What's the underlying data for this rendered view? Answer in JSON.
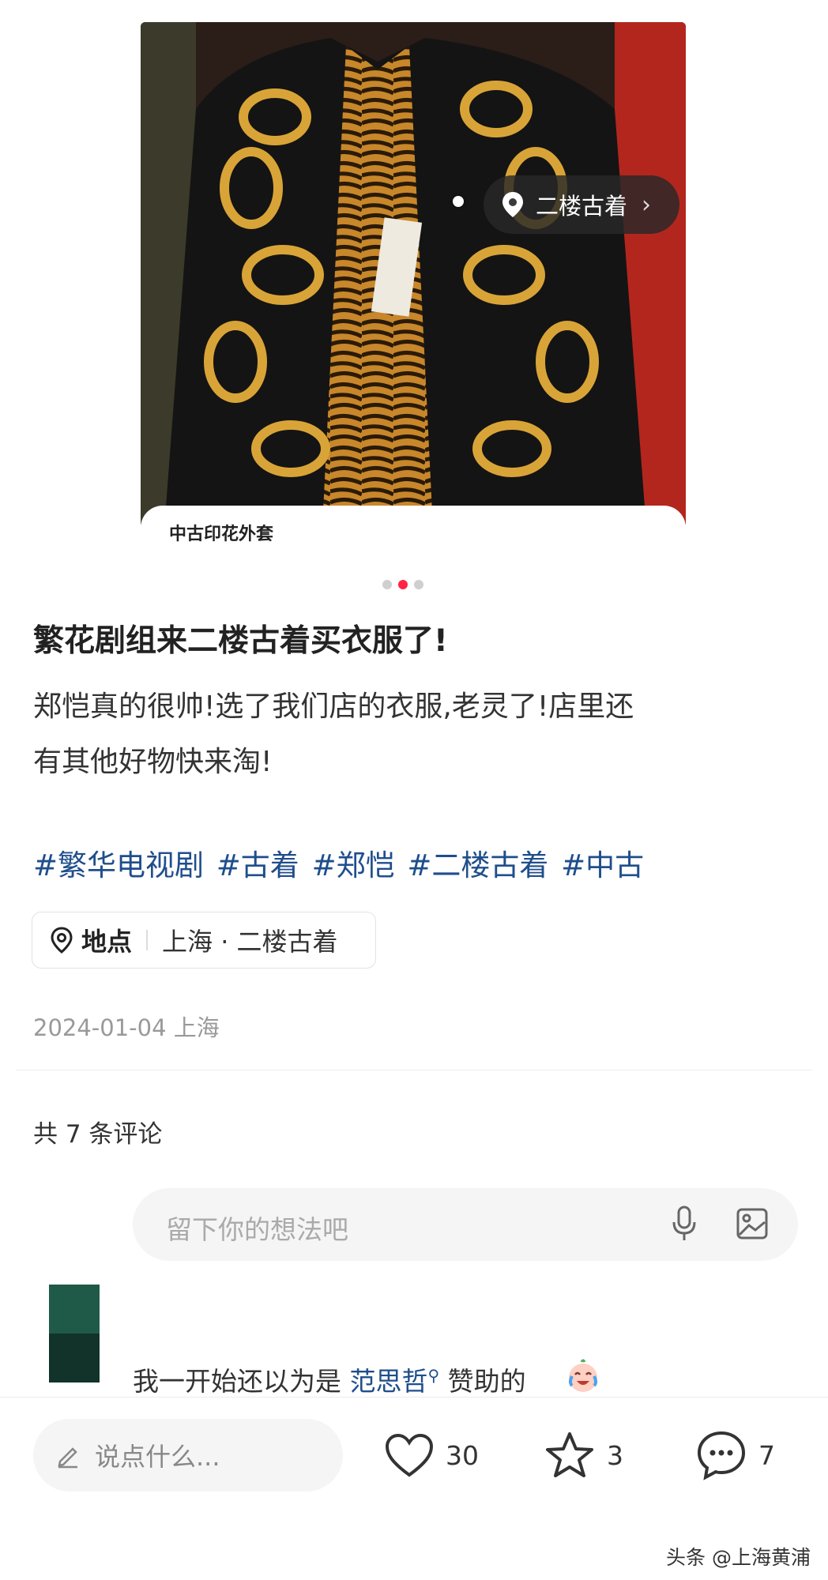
{
  "image": {
    "location_tag": "二楼古着",
    "caption": "中古印花外套",
    "carousel_active_index": 1,
    "carousel_count": 3
  },
  "post": {
    "title": "繁花剧组来二楼古着买衣服了!",
    "body_line1": "郑恺真的很帅!选了我们店的衣服,老灵了!店里还",
    "body_line2": "有其他好物快来淘!",
    "tags": [
      "#繁华电视剧",
      "#古着",
      "#郑恺",
      "#二楼古着",
      "#中古"
    ],
    "place_label": "地点",
    "place_value": "上海 · 二楼古着",
    "date": "2024-01-04 上海"
  },
  "comments": {
    "count_text": "共 7 条评论",
    "input_placeholder": "留下你的想法吧",
    "first_comment_prefix": "我一开始还以为是 ",
    "first_comment_mention": "范思哲",
    "first_comment_suffix": " 赞助的"
  },
  "bottom_bar": {
    "say_placeholder": "说点什么...",
    "likes": "30",
    "stars": "3",
    "comments": "7"
  },
  "watermark": "头条 @上海黄浦",
  "colors": {
    "accent": "#ff2442",
    "link": "#1f4e8c",
    "muted": "#999999"
  }
}
